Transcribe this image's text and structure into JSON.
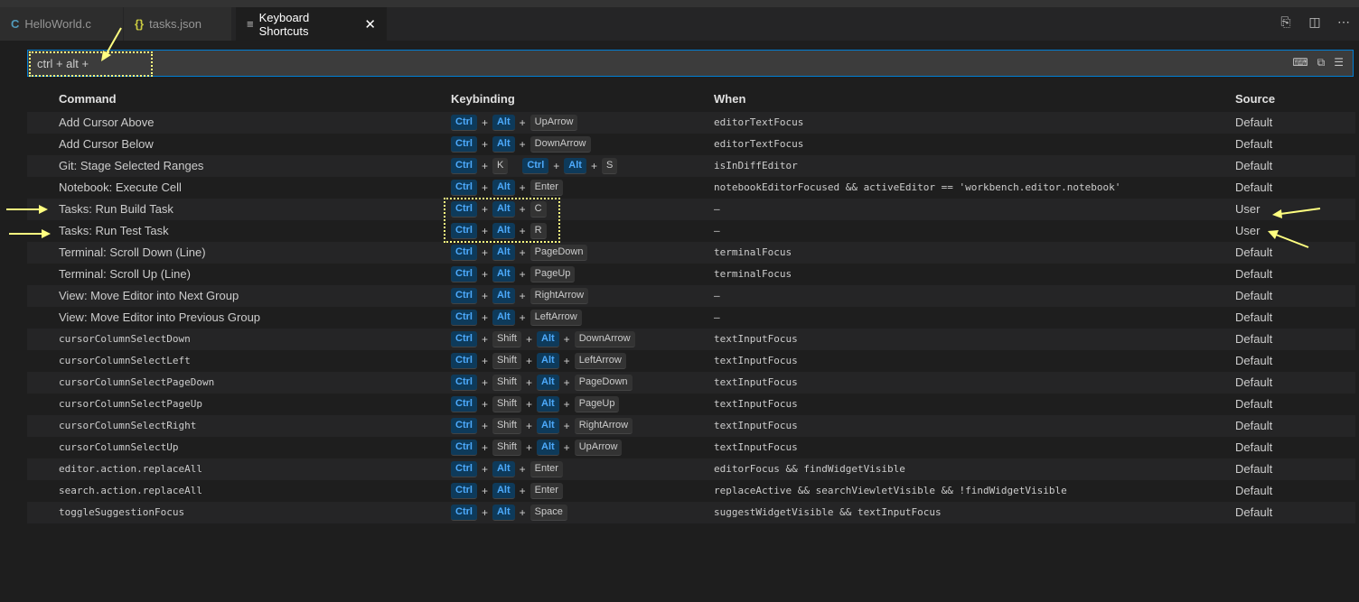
{
  "tabs": [
    {
      "label": "HelloWorld.c",
      "icon": "C",
      "icon_color": "#519aba"
    },
    {
      "label": "tasks.json",
      "icon": "{}",
      "icon_color": "#cbcb41"
    },
    {
      "label": "Keyboard Shortcuts",
      "icon": "≡",
      "icon_color": "#c5c5c5"
    }
  ],
  "tab_actions": [
    "open-json-icon",
    "split-editor-icon",
    "more-icon"
  ],
  "search": {
    "value": "ctrl + alt +"
  },
  "columns": {
    "command": "Command",
    "keybinding": "Keybinding",
    "when": "When",
    "source": "Source"
  },
  "rows": [
    {
      "command": "Add Cursor Above",
      "keys": [
        [
          "Ctrl",
          "Alt",
          "UpArrow"
        ]
      ],
      "when": "editorTextFocus",
      "source": "Default"
    },
    {
      "command": "Add Cursor Below",
      "keys": [
        [
          "Ctrl",
          "Alt",
          "DownArrow"
        ]
      ],
      "when": "editorTextFocus",
      "source": "Default"
    },
    {
      "command": "Git: Stage Selected Ranges",
      "keys": [
        [
          "Ctrl",
          "K"
        ],
        [
          "Ctrl",
          "Alt",
          "S"
        ]
      ],
      "when": "isInDiffEditor",
      "source": "Default"
    },
    {
      "command": "Notebook: Execute Cell",
      "keys": [
        [
          "Ctrl",
          "Alt",
          "Enter"
        ]
      ],
      "when": "notebookEditorFocused && activeEditor == 'workbench.editor.notebook'",
      "source": "Default"
    },
    {
      "command": "Tasks: Run Build Task",
      "keys": [
        [
          "Ctrl",
          "Alt",
          "C"
        ]
      ],
      "when": "—",
      "source": "User"
    },
    {
      "command": "Tasks: Run Test Task",
      "keys": [
        [
          "Ctrl",
          "Alt",
          "R"
        ]
      ],
      "when": "—",
      "source": "User"
    },
    {
      "command": "Terminal: Scroll Down (Line)",
      "keys": [
        [
          "Ctrl",
          "Alt",
          "PageDown"
        ]
      ],
      "when": "terminalFocus",
      "source": "Default"
    },
    {
      "command": "Terminal: Scroll Up (Line)",
      "keys": [
        [
          "Ctrl",
          "Alt",
          "PageUp"
        ]
      ],
      "when": "terminalFocus",
      "source": "Default"
    },
    {
      "command": "View: Move Editor into Next Group",
      "keys": [
        [
          "Ctrl",
          "Alt",
          "RightArrow"
        ]
      ],
      "when": "—",
      "source": "Default"
    },
    {
      "command": "View: Move Editor into Previous Group",
      "keys": [
        [
          "Ctrl",
          "Alt",
          "LeftArrow"
        ]
      ],
      "when": "—",
      "source": "Default"
    },
    {
      "command": "cursorColumnSelectDown",
      "mono": true,
      "keys": [
        [
          "Ctrl",
          "Shift",
          "Alt",
          "DownArrow"
        ]
      ],
      "when": "textInputFocus",
      "source": "Default"
    },
    {
      "command": "cursorColumnSelectLeft",
      "mono": true,
      "keys": [
        [
          "Ctrl",
          "Shift",
          "Alt",
          "LeftArrow"
        ]
      ],
      "when": "textInputFocus",
      "source": "Default"
    },
    {
      "command": "cursorColumnSelectPageDown",
      "mono": true,
      "keys": [
        [
          "Ctrl",
          "Shift",
          "Alt",
          "PageDown"
        ]
      ],
      "when": "textInputFocus",
      "source": "Default"
    },
    {
      "command": "cursorColumnSelectPageUp",
      "mono": true,
      "keys": [
        [
          "Ctrl",
          "Shift",
          "Alt",
          "PageUp"
        ]
      ],
      "when": "textInputFocus",
      "source": "Default"
    },
    {
      "command": "cursorColumnSelectRight",
      "mono": true,
      "keys": [
        [
          "Ctrl",
          "Shift",
          "Alt",
          "RightArrow"
        ]
      ],
      "when": "textInputFocus",
      "source": "Default"
    },
    {
      "command": "cursorColumnSelectUp",
      "mono": true,
      "keys": [
        [
          "Ctrl",
          "Shift",
          "Alt",
          "UpArrow"
        ]
      ],
      "when": "textInputFocus",
      "source": "Default"
    },
    {
      "command": "editor.action.replaceAll",
      "mono": true,
      "keys": [
        [
          "Ctrl",
          "Alt",
          "Enter"
        ]
      ],
      "when": "editorFocus && findWidgetVisible",
      "source": "Default"
    },
    {
      "command": "search.action.replaceAll",
      "mono": true,
      "keys": [
        [
          "Ctrl",
          "Alt",
          "Enter"
        ]
      ],
      "when": "replaceActive && searchViewletVisible && !findWidgetVisible",
      "source": "Default"
    },
    {
      "command": "toggleSuggestionFocus",
      "mono": true,
      "keys": [
        [
          "Ctrl",
          "Alt",
          "Space"
        ]
      ],
      "when": "suggestWidgetVisible && textInputFocus",
      "source": "Default"
    }
  ],
  "colors": {
    "accent": "#007fd4",
    "modifier_key": "#4daafc",
    "annotation": "#ffff80"
  }
}
